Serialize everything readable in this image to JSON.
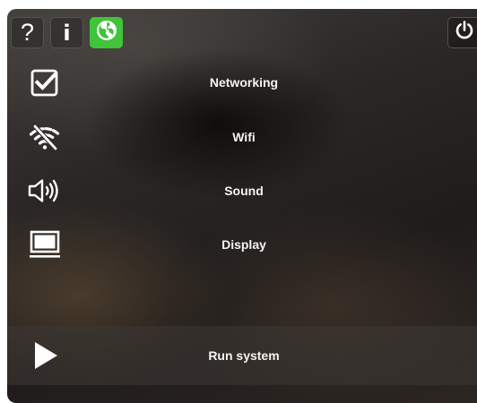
{
  "toolbar": {
    "help_label": "?",
    "info_label": "i",
    "globe_icon": "globe-icon",
    "power_icon": "power-icon",
    "accent_color": "#3fc43a"
  },
  "menu": {
    "items": [
      {
        "label": "Networking",
        "icon": "checkbox-checked-icon"
      },
      {
        "label": "Wifi",
        "icon": "wifi-off-icon"
      },
      {
        "label": "Sound",
        "icon": "speaker-icon"
      },
      {
        "label": "Display",
        "icon": "monitor-icon"
      }
    ]
  },
  "run": {
    "label": "Run system",
    "icon": "play-icon"
  }
}
